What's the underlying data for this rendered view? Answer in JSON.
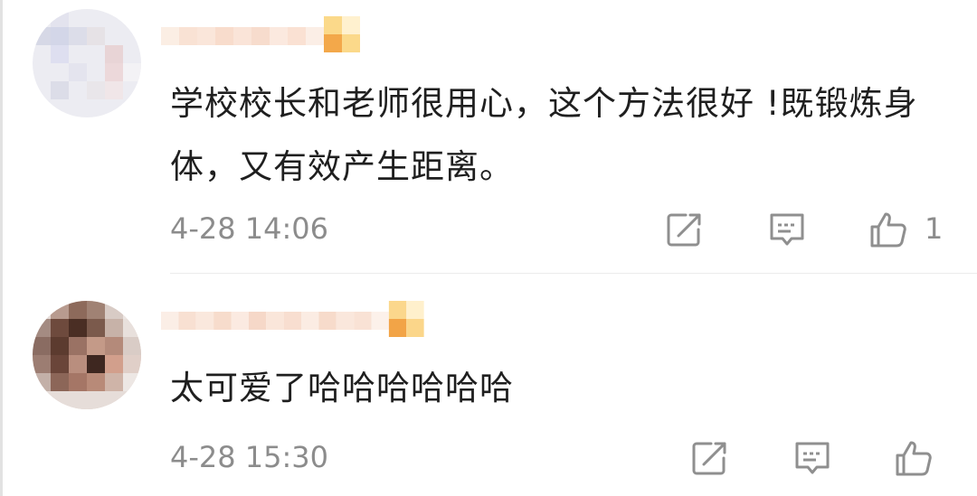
{
  "comments": [
    {
      "text": "学校校长和老师很用心，这个方法很好 !既锻炼身体，又有效产生距离。",
      "time": "4-28 14:06",
      "like_count": "1"
    },
    {
      "text": "太可爱了哈哈哈哈哈哈",
      "time": "4-28 15:30",
      "like_count": ""
    }
  ],
  "icons": {
    "share": "share-icon",
    "reply": "reply-icon",
    "like": "like-icon"
  },
  "colors": {
    "text": "#1f1f1f",
    "meta": "#8c8c8c",
    "icon": "#8f8f8f",
    "badge": "#f0a040"
  }
}
